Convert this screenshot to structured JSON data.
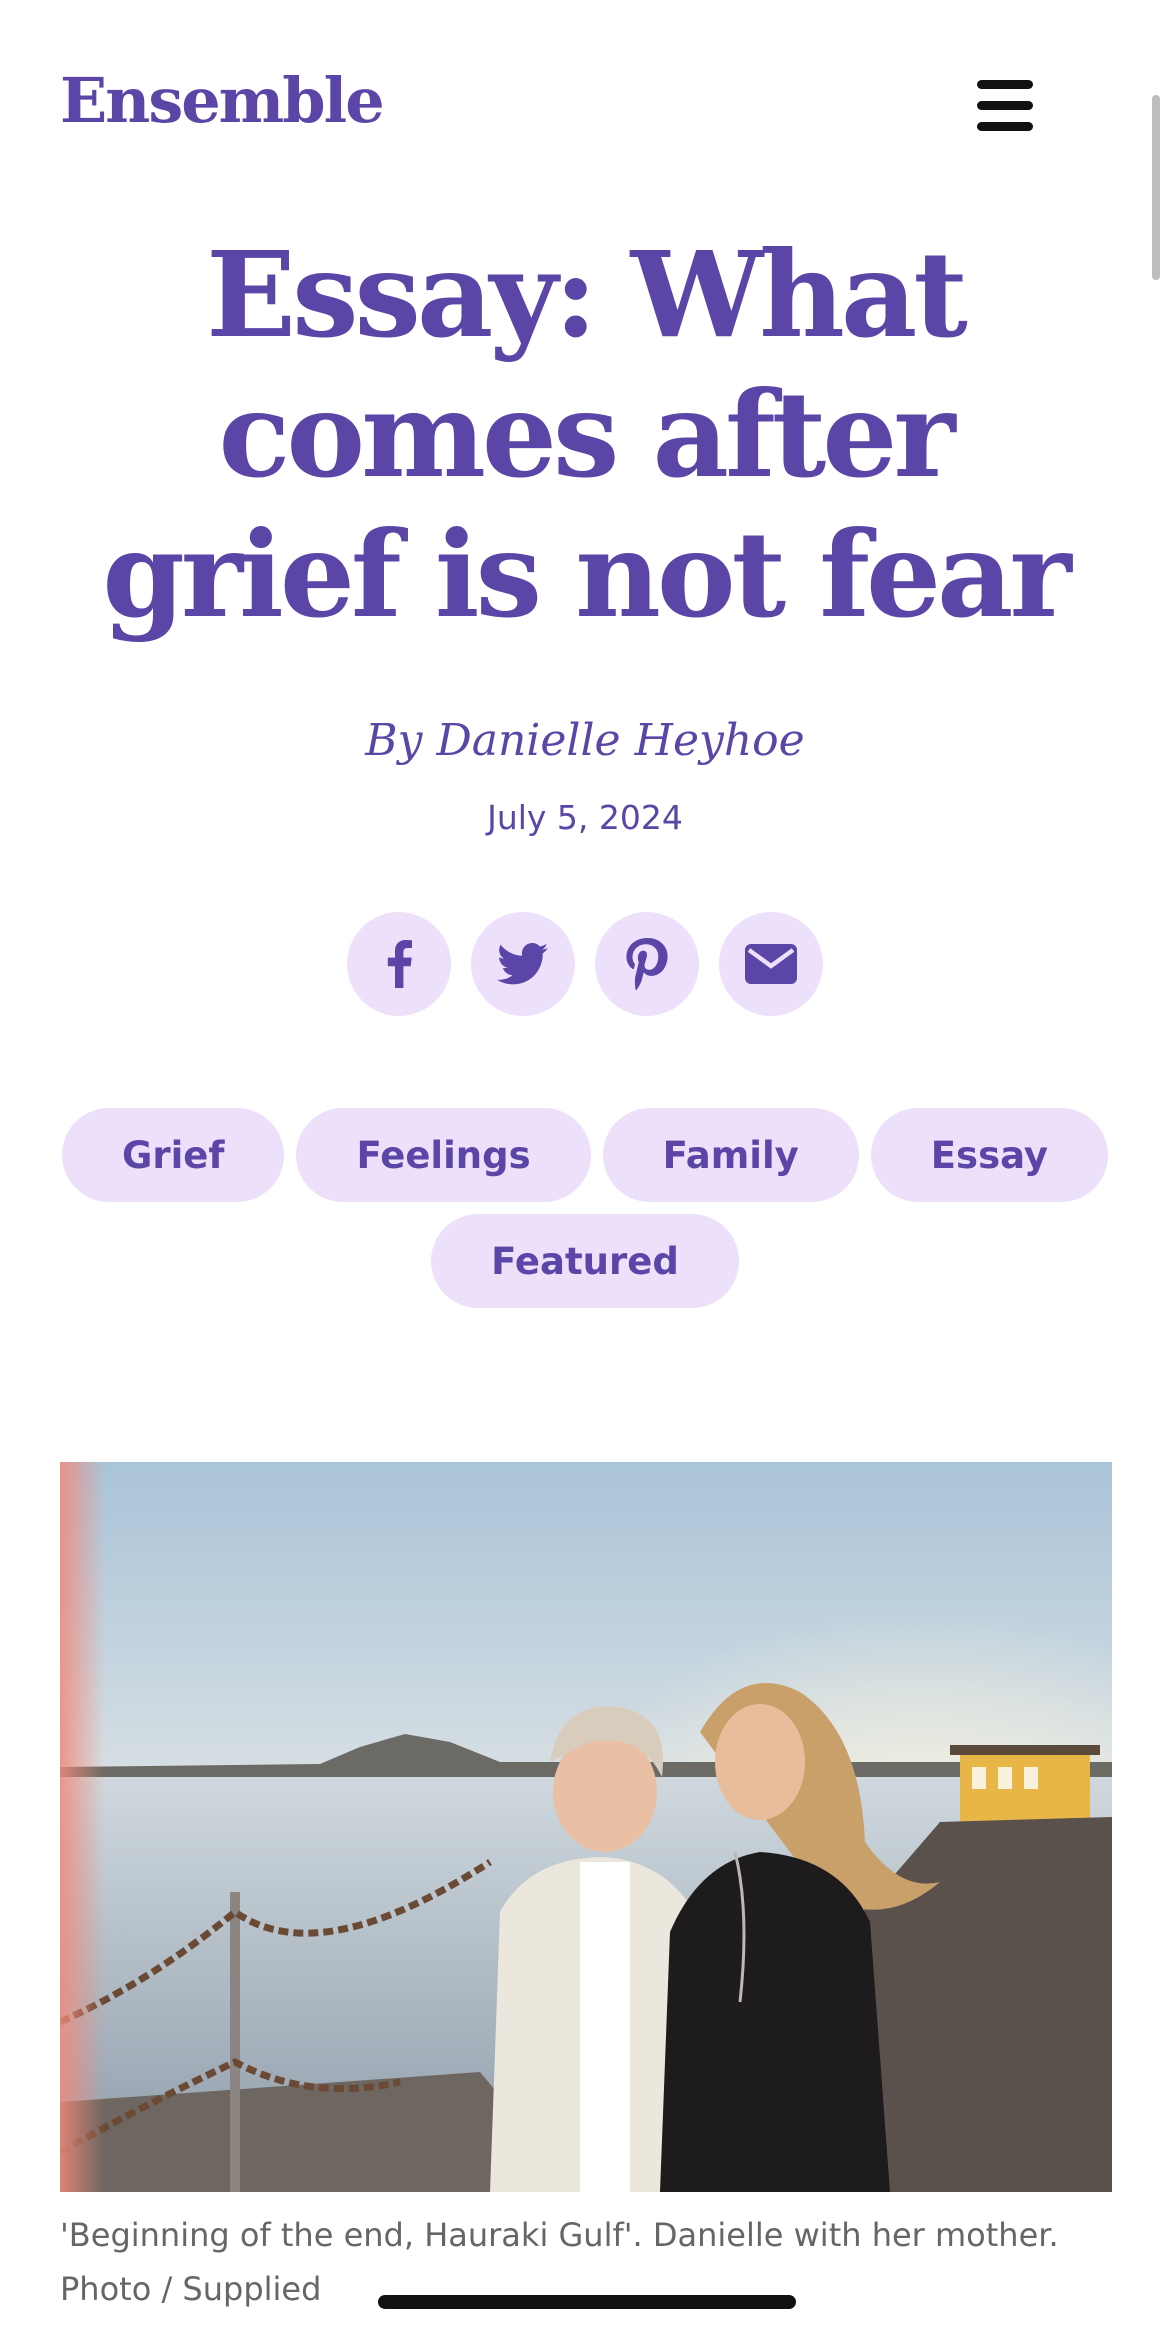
{
  "header": {
    "logo": "Ensemble",
    "menu_icon": "hamburger-menu-icon"
  },
  "article": {
    "title": "Essay: What comes after grief is not fear",
    "byline": "By Danielle Heyhoe",
    "date": "July 5, 2024"
  },
  "share": {
    "icons": [
      "facebook-icon",
      "twitter-icon",
      "pinterest-icon",
      "email-icon"
    ]
  },
  "tags": [
    "Grief",
    "Feelings",
    "Family",
    "Essay",
    "Featured"
  ],
  "image": {
    "caption": "'Beginning of the end, Hauraki Gulf'. Danielle with her mother. Photo / Supplied"
  },
  "colors": {
    "brand_purple": "#5b45a6",
    "pill_background": "#ece0fb",
    "caption_gray": "#666666"
  }
}
